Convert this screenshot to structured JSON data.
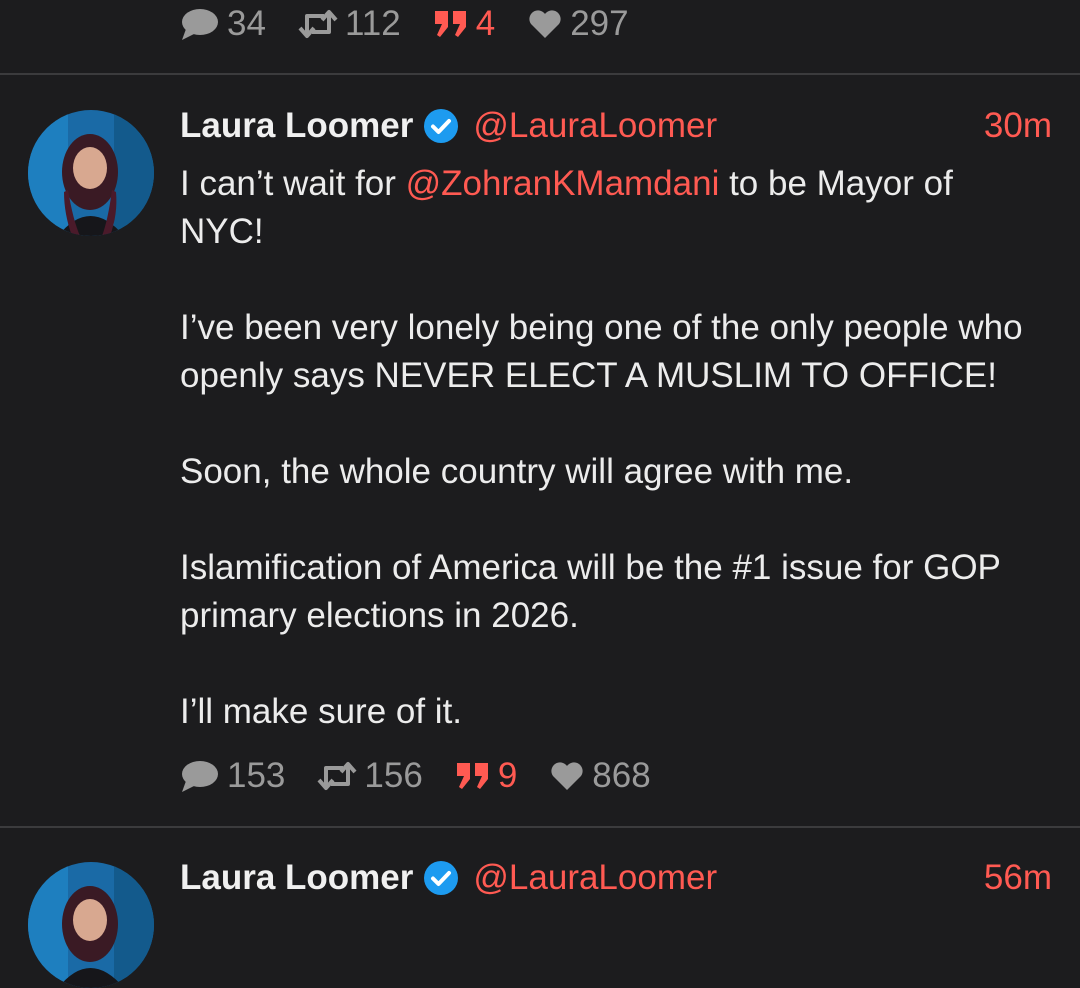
{
  "prev_post": {
    "stats": {
      "replies": "34",
      "reposts": "112",
      "quotes": "4",
      "likes": "297"
    }
  },
  "post": {
    "author_name": "Laura Loomer",
    "handle": "@LauraLoomer",
    "time": "30m",
    "body": {
      "line1_prefix": "I can’t wait for ",
      "line1_mention": "@ZohranKMamdani",
      "line1_suffix": " to be Mayor of",
      "line2": "NYC!",
      "line3": "I’ve been very lonely being one of the only people who",
      "line4": "openly says NEVER ELECT A MUSLIM TO OFFICE!",
      "line5": "Soon, the whole country will agree with me.",
      "line6": "Islamification of America will be the #1 issue for GOP",
      "line7": "primary elections in 2026.",
      "line8": "I’ll make sure of it."
    },
    "stats": {
      "replies": "153",
      "reposts": "156",
      "quotes": "9",
      "likes": "868"
    }
  },
  "next_post": {
    "author_name": "Laura Loomer",
    "handle": "@LauraLoomer",
    "time": "56m"
  },
  "icons": {
    "reply": "speech-bubble-icon",
    "repost": "repost-arrows-icon",
    "quote": "quote-marks-icon",
    "like": "heart-icon",
    "verified": "verified-check-icon"
  },
  "colors": {
    "background": "#1c1c1e",
    "accent": "#ff5a52",
    "verified": "#1d9bf0",
    "muted": "#9a9a9a",
    "text": "#ececec"
  }
}
